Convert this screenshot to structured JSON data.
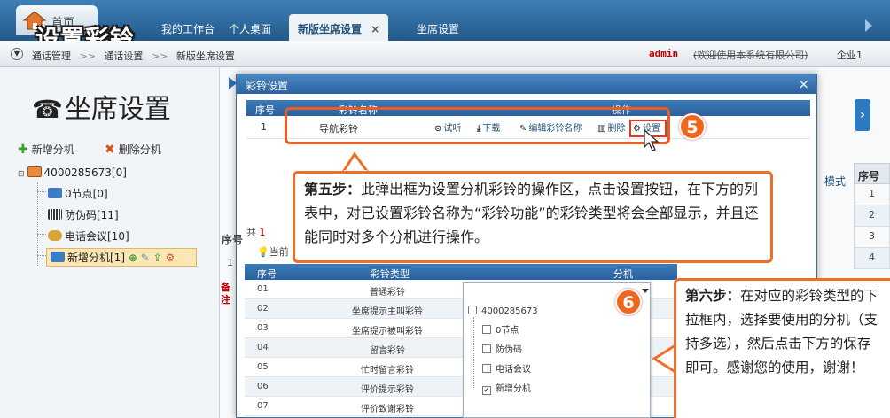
{
  "overlay_title": "设置彩铃",
  "topbar": {
    "home_label": "首页",
    "tabs": [
      {
        "label": "我的工作台"
      },
      {
        "label": "个人桌面"
      },
      {
        "label": "新版坐席设置",
        "close": "×"
      },
      {
        "label": "坐席设置"
      }
    ]
  },
  "breadcrumb": {
    "items": [
      "通话管理",
      "通话设置",
      "新版坐席设置"
    ],
    "separator": ">>",
    "user": "admin",
    "company": "(欢迎使用本系统有限公司)",
    "enterprise": "企业1"
  },
  "left": {
    "heading": "坐席设置",
    "add_label": "新增分机",
    "delete_label": "删除分机",
    "tree": {
      "root": "4000285673[0]",
      "children": [
        "0节点[0]",
        "防伪码[11]",
        "电话会议[10]",
        "新增分机[1]"
      ]
    }
  },
  "right": {
    "mode_text": "模式",
    "seq_header": "序号",
    "seq_values": [
      "1",
      "2",
      "3",
      "4"
    ]
  },
  "dialog": {
    "title": "彩铃设置",
    "close": "×",
    "head": {
      "seq": "序号",
      "name": "彩铃名称",
      "ops": "操作"
    },
    "row": {
      "seq": "1",
      "name": "导航彩铃",
      "ops": [
        "试听",
        "下载",
        "编辑彩铃名称",
        "删除",
        "设置"
      ]
    }
  },
  "step5": {
    "badge": "5",
    "label": "第五步：",
    "text": "此弹出框为设置分机彩铃的操作区，点击设置按钮，在下方的列表中，对已设置彩铃名称为“彩铃功能”的彩铃类型将会全部显示，并且还能同时对多个分机进行操作。"
  },
  "background": {
    "count_prefix": "共",
    "count_value": "1",
    "current_prefix": "当前",
    "note_text": "备注",
    "seq_left": "序号",
    "one_left": "1"
  },
  "sub_table": {
    "head": {
      "seq": "序号",
      "type": "彩铃类型",
      "ext": "分机"
    },
    "rows": [
      {
        "n": "01",
        "t": "普通彩铃"
      },
      {
        "n": "02",
        "t": "坐席提示主叫彩铃"
      },
      {
        "n": "03",
        "t": "坐席提示被叫彩铃"
      },
      {
        "n": "04",
        "t": "留言彩铃"
      },
      {
        "n": "05",
        "t": "忙时留言彩铃"
      },
      {
        "n": "06",
        "t": "评价提示彩铃"
      },
      {
        "n": "07",
        "t": "评价致谢彩铃"
      }
    ]
  },
  "step6": {
    "badge": "6",
    "label": "第六步：",
    "text": "在对应的彩铃类型的下拉框内，选择要使用的分机（支持多选），然后点击下方的保存即可。感谢您的使用，谢谢！"
  },
  "dropdown": {
    "root": "4000285673",
    "items": [
      {
        "label": "0节点",
        "checked": false
      },
      {
        "label": "防伪码",
        "checked": false
      },
      {
        "label": "电话会议",
        "checked": false
      },
      {
        "label": "新增分机",
        "checked": true
      }
    ],
    "check_mark": "✓"
  },
  "colors": {
    "accent": "#ef6d27",
    "header_blue": "#2a609d",
    "topbar_blue": "#23598b"
  }
}
